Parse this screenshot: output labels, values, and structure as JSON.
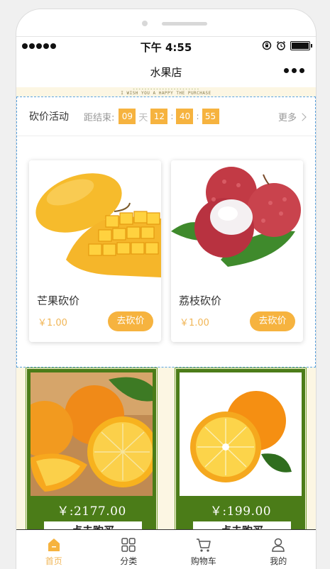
{
  "status_bar": {
    "time": "下午 4:55"
  },
  "nav": {
    "title": "水果店"
  },
  "marquee": {
    "line1": "-----------------------",
    "line2": "I WISH YOU A HAPPY THE PURCHASE"
  },
  "bargain": {
    "title": "砍价活动",
    "countdown_label": "距结束:",
    "days": "09",
    "day_unit": "天",
    "hours": "12",
    "minutes": "40",
    "seconds": "55",
    "sep": ":",
    "more": "更多",
    "items": [
      {
        "name": "芒果砍价",
        "price": "￥1.00",
        "button": "去砍价"
      },
      {
        "name": "荔枝砍价",
        "price": "￥1.00",
        "button": "去砍价"
      }
    ]
  },
  "products": [
    {
      "price": "￥:2177.00",
      "button": "点击购买"
    },
    {
      "price": "￥:199.00",
      "button": "点击购买"
    }
  ],
  "tabbar": [
    {
      "label": "首页",
      "icon": "home-icon",
      "active": true
    },
    {
      "label": "分类",
      "icon": "category-icon",
      "active": false
    },
    {
      "label": "购物车",
      "icon": "cart-icon",
      "active": false
    },
    {
      "label": "我的",
      "icon": "user-icon",
      "active": false
    }
  ],
  "colors": {
    "accent": "#f6b33f",
    "product_frame": "#4b7c18",
    "content_bg": "#fcf6e3"
  }
}
